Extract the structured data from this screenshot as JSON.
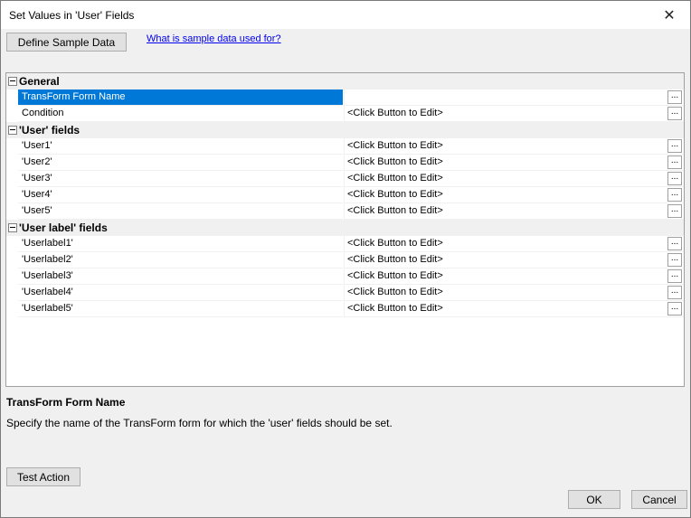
{
  "window": {
    "title": "Set Values in 'User' Fields",
    "close_symbol": "✕"
  },
  "toolbar": {
    "define_sample_label": "Define Sample Data",
    "sample_link_label": "What is sample data used for?"
  },
  "grid": {
    "general": {
      "label": "General",
      "form_name": {
        "name": "TransForm Form Name",
        "value": ""
      },
      "condition": {
        "name": "Condition",
        "value": "<Click Button to Edit>"
      }
    },
    "user_fields": {
      "label": "'User' fields",
      "items": [
        {
          "name": "'User1'",
          "value": "<Click Button to Edit>"
        },
        {
          "name": "'User2'",
          "value": "<Click Button to Edit>"
        },
        {
          "name": "'User3'",
          "value": "<Click Button to Edit>"
        },
        {
          "name": "'User4'",
          "value": "<Click Button to Edit>"
        },
        {
          "name": "'User5'",
          "value": "<Click Button to Edit>"
        }
      ]
    },
    "userlabel_fields": {
      "label": "'User label' fields",
      "items": [
        {
          "name": "'Userlabel1'",
          "value": "<Click Button to Edit>"
        },
        {
          "name": "'Userlabel2'",
          "value": "<Click Button to Edit>"
        },
        {
          "name": "'Userlabel3'",
          "value": "<Click Button to Edit>"
        },
        {
          "name": "'Userlabel4'",
          "value": "<Click Button to Edit>"
        },
        {
          "name": "'Userlabel5'",
          "value": "<Click Button to Edit>"
        }
      ]
    },
    "ellipsis": "..."
  },
  "help": {
    "title": "TransForm Form Name",
    "description": "Specify the name of the TransForm form for which the 'user' fields should be set."
  },
  "footer": {
    "test_action_label": "Test Action",
    "ok_label": "OK",
    "cancel_label": "Cancel"
  }
}
